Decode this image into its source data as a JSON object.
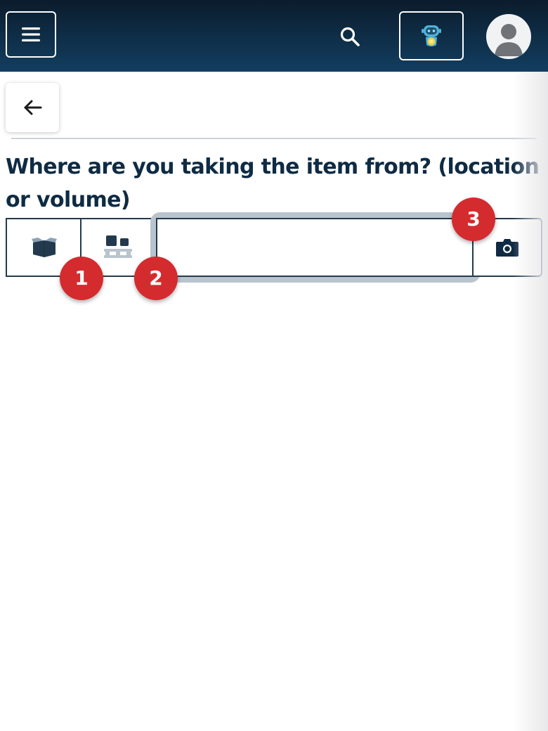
{
  "header": {
    "menu_icon": "hamburger-menu-icon",
    "search_icon": "search-icon",
    "assistant_icon": "robot-assistant-icon",
    "avatar_icon": "user-avatar-icon",
    "background_color": "#123e60"
  },
  "back": {
    "icon": "arrow-left-icon"
  },
  "question": {
    "text": "Where are you taking the item from? (location or volume)"
  },
  "source_selector": {
    "box_icon": "open-box-icon",
    "pallet_icon": "pallet-icon",
    "input_value": "",
    "input_placeholder": "",
    "camera_icon": "camera-icon"
  },
  "badges": [
    "1",
    "2",
    "3"
  ],
  "colors": {
    "accent": "#0f2b44",
    "badge": "#d42b2f",
    "focus_ring": "#b9c4cd"
  }
}
